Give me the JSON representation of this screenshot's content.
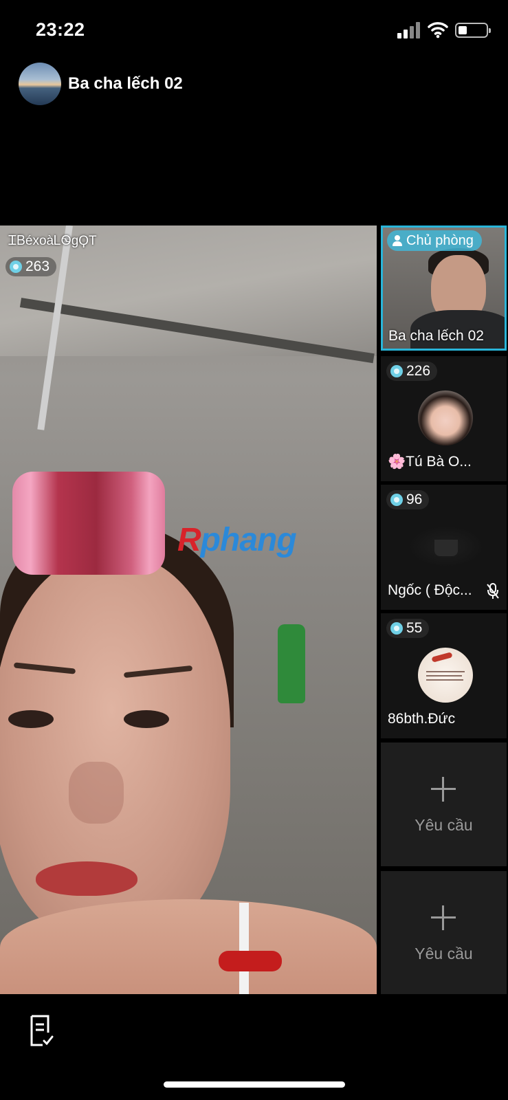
{
  "status_bar": {
    "time": "23:22"
  },
  "room": {
    "title": "Ba cha lếch 02"
  },
  "main_stage": {
    "username": "ᏆᏴéxoàᏞᏫ‌ɡϘТ",
    "gem_count": "263",
    "watermark_r": "R",
    "watermark_rest": "phang"
  },
  "seats": [
    {
      "badge": "Chủ phòng",
      "name": "Ba cha lếch 02"
    },
    {
      "gem_count": "226",
      "name": "🌸Tú Bà O..."
    },
    {
      "gem_count": "96",
      "name": "Ngốc ( Độc...",
      "muted": true
    },
    {
      "gem_count": "55",
      "name": "86bth.Đức"
    },
    {
      "request_label": "Yêu cầu"
    },
    {
      "request_label": "Yêu cầu"
    }
  ],
  "colors": {
    "accent": "#29b5d9",
    "background": "#000000",
    "seat_bg": "#141414"
  },
  "icons": [
    "signal-icon",
    "wifi-icon",
    "battery-icon",
    "gem-icon",
    "person-icon",
    "mic-off-icon",
    "plus-icon",
    "note-check-icon"
  ]
}
